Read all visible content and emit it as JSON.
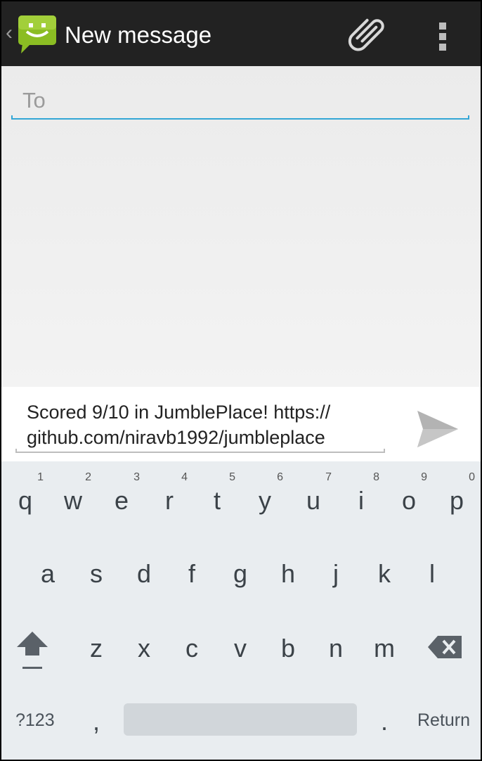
{
  "action_bar": {
    "title": "New message",
    "app_icon": "messaging-smiley-icon",
    "attach_icon": "paperclip-icon",
    "overflow_icon": "overflow-menu-icon",
    "background": "#222222"
  },
  "recipient": {
    "placeholder": "To",
    "value": "",
    "accent": "#33a6d6"
  },
  "compose": {
    "message_line1": "Scored 9/10 in JumblePlace! https://",
    "message_line2": "github.com/niravb1992/jumbleplace",
    "send_icon": "send-icon"
  },
  "keyboard": {
    "row1": [
      {
        "key": "q",
        "hint": "1"
      },
      {
        "key": "w",
        "hint": "2"
      },
      {
        "key": "e",
        "hint": "3"
      },
      {
        "key": "r",
        "hint": "4"
      },
      {
        "key": "t",
        "hint": "5"
      },
      {
        "key": "y",
        "hint": "6"
      },
      {
        "key": "u",
        "hint": "7"
      },
      {
        "key": "i",
        "hint": "8"
      },
      {
        "key": "o",
        "hint": "9"
      },
      {
        "key": "p",
        "hint": "0"
      }
    ],
    "row2": [
      "a",
      "s",
      "d",
      "f",
      "g",
      "h",
      "j",
      "k",
      "l"
    ],
    "row3": [
      "z",
      "x",
      "c",
      "v",
      "b",
      "n",
      "m"
    ],
    "symbols_label": "?123",
    "comma": ",",
    "period": ".",
    "return_label": "Return",
    "shift_icon": "shift-arrow-icon",
    "delete_icon": "backspace-icon"
  }
}
